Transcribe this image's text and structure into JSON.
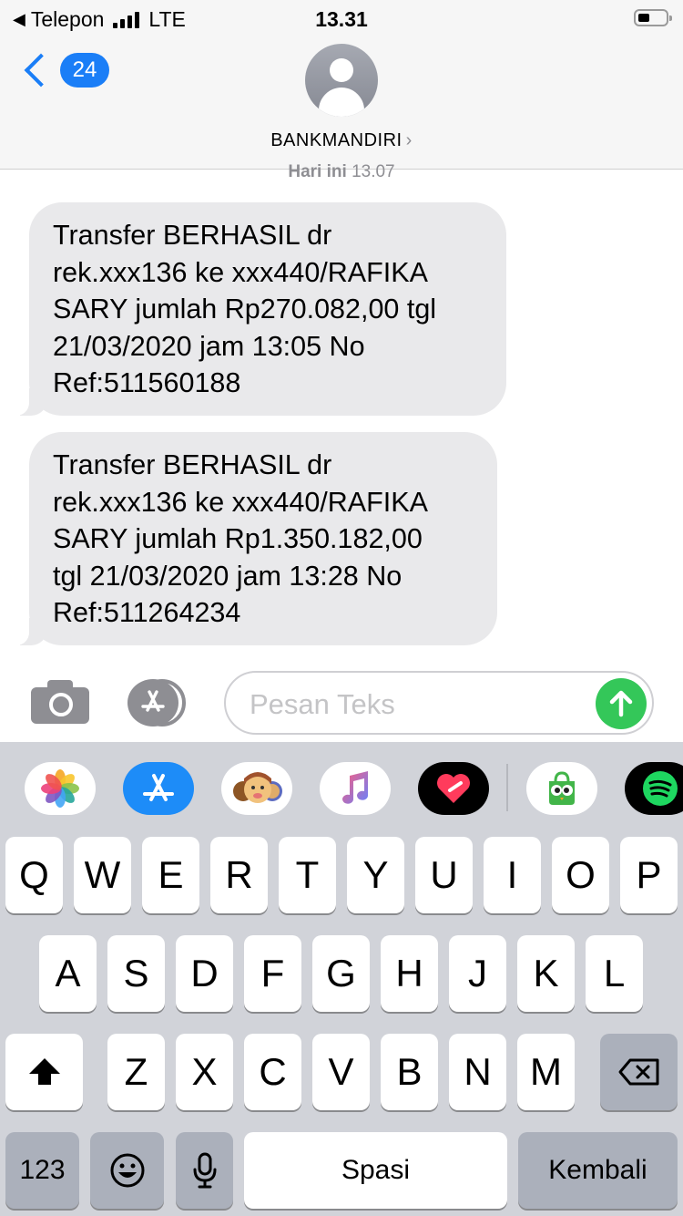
{
  "status_bar": {
    "back_app": "Telepon",
    "network": "LTE",
    "time": "13.31"
  },
  "nav": {
    "back_count": "24",
    "contact_name": "BANKMANDIRI",
    "chevron": "›"
  },
  "conversation": {
    "timestamp_day": "Hari ini",
    "timestamp_time": "13.07",
    "messages": [
      {
        "text": "Transfer BERHASIL dr\nrek.xxx136 ke xxx440/RAFIKA\nSARY jumlah Rp270.082,00 tgl\n21/03/2020 jam 13:05 No\nRef:511560188"
      },
      {
        "text": "Transfer BERHASIL dr\nrek.xxx136 ke xxx440/RAFIKA\nSARY jumlah Rp1.350.182,00\ntgl 21/03/2020 jam 13:28 No\nRef:511264234"
      }
    ]
  },
  "input_bar": {
    "placeholder": "Pesan Teks",
    "icons": [
      "camera-icon",
      "app-store-icon",
      "send-arrow-icon"
    ],
    "send_color": "#34c759"
  },
  "app_drawer": {
    "apps": [
      "photos",
      "app-store",
      "memoji",
      "music",
      "digital-touch",
      "tokopedia",
      "spotify"
    ]
  },
  "keyboard": {
    "row1": [
      "Q",
      "W",
      "E",
      "R",
      "T",
      "Y",
      "U",
      "I",
      "O",
      "P"
    ],
    "row2": [
      "A",
      "S",
      "D",
      "F",
      "G",
      "H",
      "J",
      "K",
      "L"
    ],
    "row3": [
      "Z",
      "X",
      "C",
      "V",
      "B",
      "N",
      "M"
    ],
    "numbers_label": "123",
    "space_label": "Spasi",
    "return_label": "Kembali"
  },
  "colors": {
    "accent": "#1a7ef7",
    "bubble": "#e9e9eb",
    "keyboard_bg": "#d1d3d9"
  }
}
